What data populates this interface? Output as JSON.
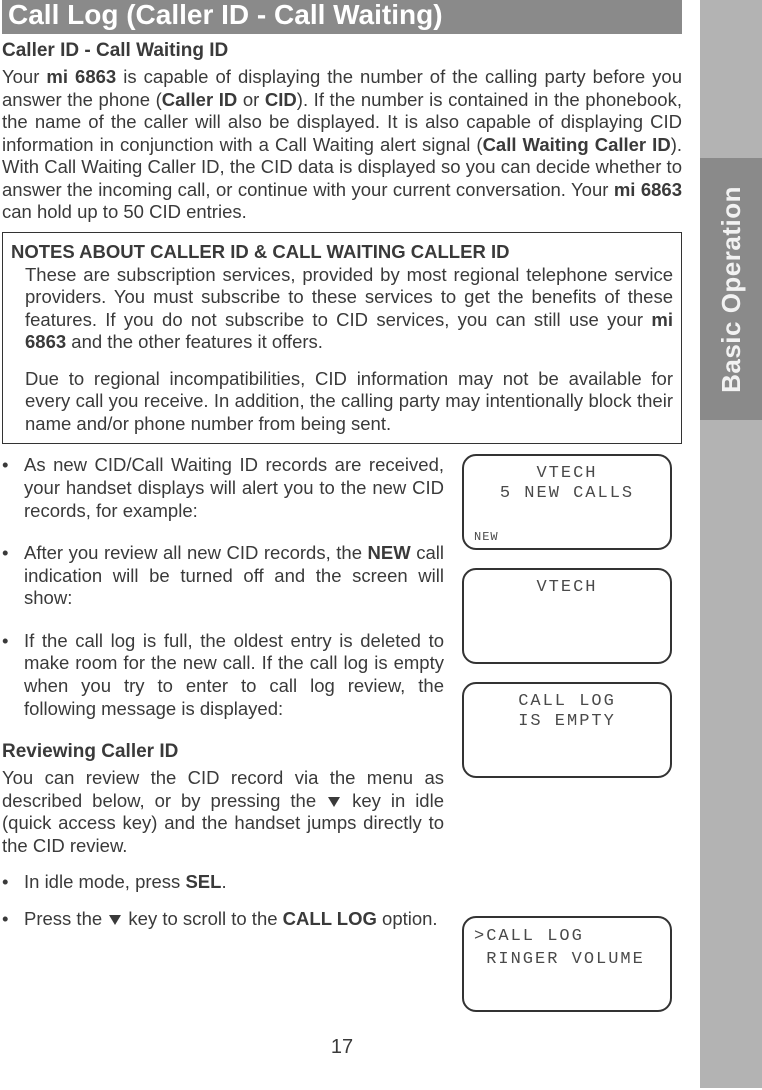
{
  "sideTab": "Basic Operation",
  "h1": "Call Log (Caller ID - Call Waiting)",
  "section1": {
    "heading": "Caller ID - Call Waiting ID",
    "p1a": "Your ",
    "p1b": "mi 6863",
    "p1c": " is capable of displaying the number of the calling party before you answer the phone (",
    "p1d": "Caller ID",
    "p1e": " or  ",
    "p1f": "CID",
    "p1g": "). If the number is contained in the phonebook, the name of the caller will also be displayed. It is also capable of displaying CID information in conjunction with a Call Waiting alert signal (",
    "p1h": "Call Waiting Caller ID",
    "p1i": "). With Call Waiting Caller ID, the CID data is displayed so you can decide whether to answer the incoming call, or continue with your current conversation. Your ",
    "p1j": "mi 6863",
    "p1k": " can hold up to 50 CID entries."
  },
  "notes": {
    "title": "NOTES ABOUT CALLER ID & CALL WAITING CALLER ID",
    "p1a": "These are subscription services, provided by most regional telephone service providers. You must subscribe to these services to get the benefits of these features. If you do not subscribe to CID services, you can still use your ",
    "p1b": "mi 6863",
    "p1c": " and the other features it offers.",
    "p2": "Due to regional incompatibilities, CID information may not be available for every call you receive. In addition, the calling party may intentionally block their name and/or phone number from being sent."
  },
  "bullets": {
    "b1": "As new CID/Call Waiting ID records are received, your handset displays will alert  you to the new CID records, for example:",
    "b2a": "After you review all new CID records, the ",
    "b2b": "NEW",
    "b2c": " call indication will be turned off and the screen will show:",
    "b3": "If the call log is full, the oldest entry is deleted to make room for the new call. If the call log is empty when you try to enter to call log review, the following message is displayed:"
  },
  "section2": {
    "heading": "Reviewing Caller ID",
    "p1a": "You can review the CID record via the menu as described below, or by pressing the ",
    "p1b": " key in idle (quick access key) and the handset jumps directly to the CID review.",
    "b1a": "In idle mode, press ",
    "b1b": "SEL",
    "b1c": ".",
    "b2a": "Press the ",
    "b2b": " key to scroll to the  ",
    "b2c": "CALL LOG",
    "b2d": " option."
  },
  "lcd1": {
    "l1": "VTECH",
    "l2": "5 NEW CALLS",
    "new": "NEW"
  },
  "lcd2": {
    "l1": "VTECH"
  },
  "lcd3": {
    "l1": "CALL LOG",
    "l2": "IS EMPTY"
  },
  "lcd4": {
    "menu": ">CALL LOG\n RINGER VOLUME"
  },
  "pageNumber": "17"
}
